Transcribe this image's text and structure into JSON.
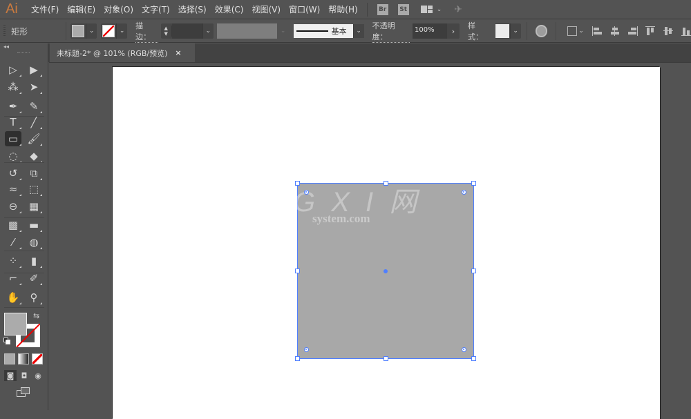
{
  "app": {
    "logo": "Ai"
  },
  "menu": {
    "items": [
      "文件(F)",
      "编辑(E)",
      "对象(O)",
      "文字(T)",
      "选择(S)",
      "效果(C)",
      "视图(V)",
      "窗口(W)",
      "帮助(H)"
    ],
    "bridge_label": "Br",
    "stock_label": "St",
    "workspace_icon": "workspace-switcher-icon",
    "sync_icon": "sync-settings-icon"
  },
  "control": {
    "selection_label": "矩形",
    "fill_color": "#ababab",
    "stroke_color": "none",
    "stroke_label": "描边：",
    "stroke_weight": "",
    "profile_label": "基本",
    "opacity_label": "不透明度：",
    "opacity_value": "100%",
    "style_label": "样式："
  },
  "document": {
    "tab_title": "未标题-2* @ 101% (RGB/预览)",
    "close_glyph": "×"
  },
  "tools": {
    "collapse_glyph": "◂◂",
    "items": [
      {
        "name": "selection-tool",
        "glyph": "▷"
      },
      {
        "name": "direct-selection-tool",
        "glyph": "▶"
      },
      {
        "name": "magic-wand-tool",
        "glyph": "⁂"
      },
      {
        "name": "lasso-tool",
        "glyph": "➤"
      },
      {
        "name": "pen-tool",
        "glyph": "✒"
      },
      {
        "name": "curvature-tool",
        "glyph": "✎"
      },
      {
        "name": "type-tool",
        "glyph": "T"
      },
      {
        "name": "line-segment-tool",
        "glyph": "╱"
      },
      {
        "name": "rectangle-tool",
        "glyph": "▭"
      },
      {
        "name": "paintbrush-tool",
        "glyph": "🖌"
      },
      {
        "name": "shaper-tool",
        "glyph": "◌"
      },
      {
        "name": "eraser-tool",
        "glyph": "◆"
      },
      {
        "name": "rotate-tool",
        "glyph": "↺"
      },
      {
        "name": "scale-tool",
        "glyph": "⧉"
      },
      {
        "name": "warp-tool",
        "glyph": "≈"
      },
      {
        "name": "free-transform-tool",
        "glyph": "⬚"
      },
      {
        "name": "shape-builder-tool",
        "glyph": "⊖"
      },
      {
        "name": "perspective-grid-tool",
        "glyph": "▦"
      },
      {
        "name": "mesh-tool",
        "glyph": "▩"
      },
      {
        "name": "gradient-tool",
        "glyph": "▬"
      },
      {
        "name": "eyedropper-tool",
        "glyph": "⁄"
      },
      {
        "name": "blend-tool",
        "glyph": "◍"
      },
      {
        "name": "symbol-sprayer-tool",
        "glyph": "⁘"
      },
      {
        "name": "column-graph-tool",
        "glyph": "▮"
      },
      {
        "name": "artboard-tool",
        "glyph": "⌐"
      },
      {
        "name": "slice-tool",
        "glyph": "✐"
      },
      {
        "name": "hand-tool",
        "glyph": "✋"
      },
      {
        "name": "zoom-tool",
        "glyph": "⚲"
      }
    ],
    "swap_glyph": "⇆",
    "draw_modes": [
      "◙",
      "◘",
      "◉"
    ]
  },
  "canvas": {
    "shape_fill": "#a8a8a8",
    "selection_color": "#4f7fff",
    "watermark_main": "G X I 网",
    "watermark_sub": "system.com"
  }
}
